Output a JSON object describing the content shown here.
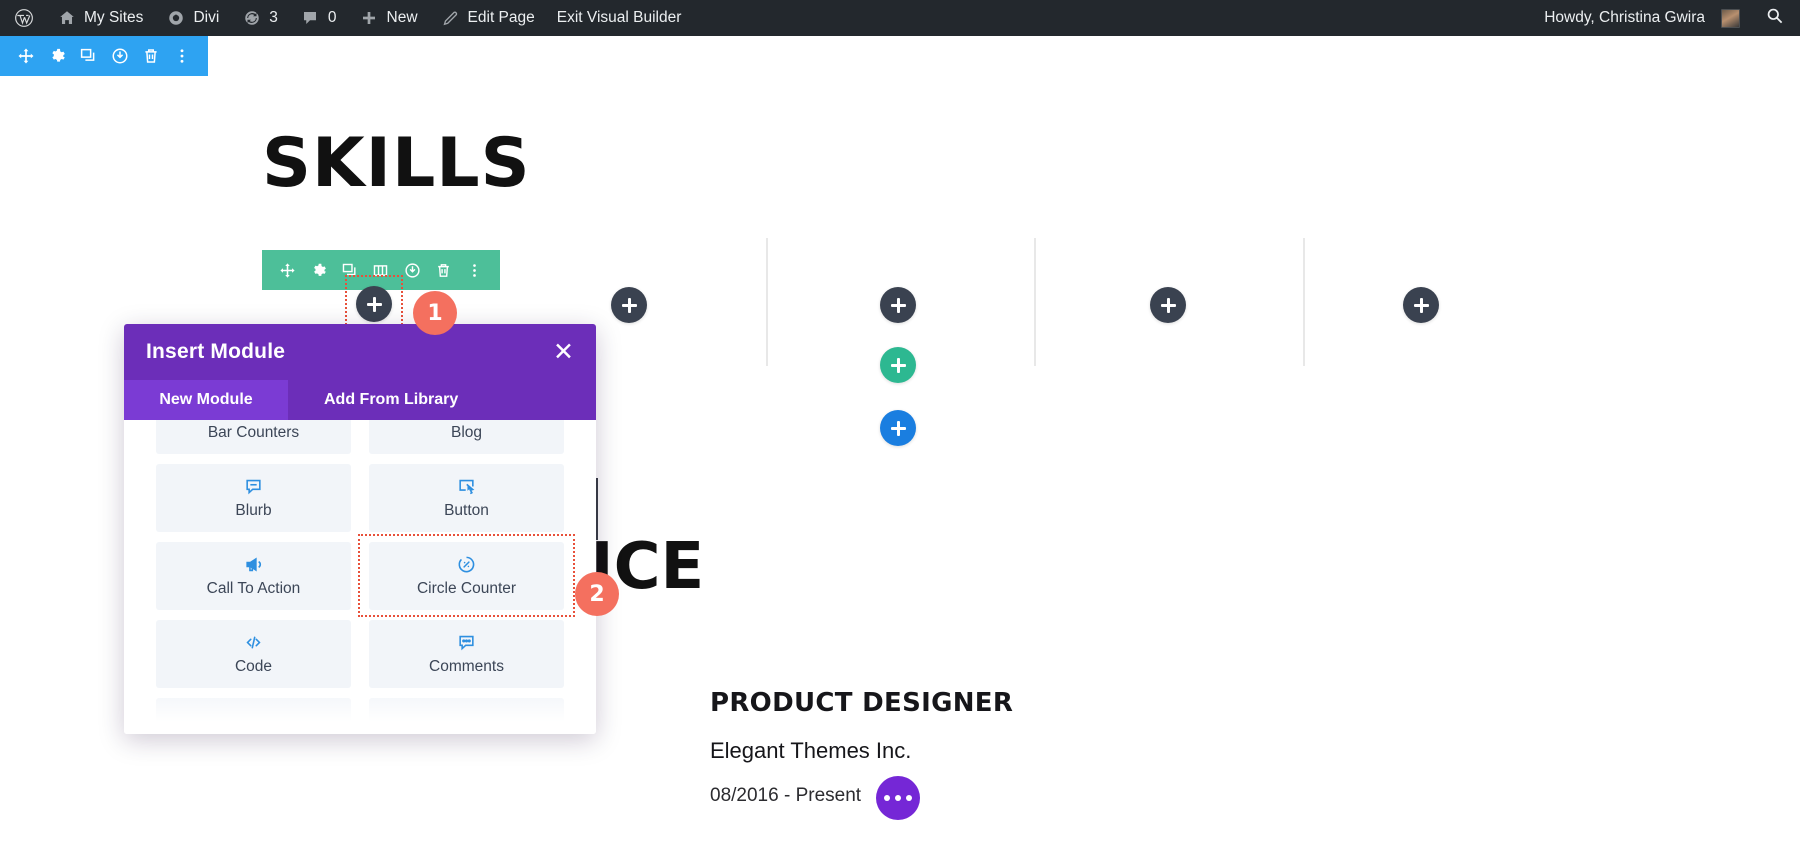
{
  "adminbar": {
    "items": [
      {
        "icon": "wordpress-logo-icon",
        "label": ""
      },
      {
        "icon": "home-icon",
        "label": "My Sites"
      },
      {
        "icon": "divi-gauge-icon",
        "label": "Divi"
      },
      {
        "icon": "update-arrows-icon",
        "label": "3"
      },
      {
        "icon": "comment-bubble-icon",
        "label": "0"
      },
      {
        "icon": "plus-icon",
        "label": "New"
      },
      {
        "icon": "pencil-icon",
        "label": "Edit Page"
      },
      {
        "icon": "",
        "label": "Exit Visual Builder"
      }
    ],
    "howdy": "Howdy, Christina Gwira",
    "search_icon": "search-icon"
  },
  "section_toolbar": {
    "color": "#2ea3f2",
    "icons": [
      "move-icon",
      "gear-icon",
      "duplicate-icon",
      "save-power-icon",
      "trash-icon",
      "more-vertical-icon"
    ]
  },
  "row_toolbar": {
    "color": "#4dbf99",
    "icons": [
      "move-icon",
      "gear-icon",
      "duplicate-icon",
      "columns-icon",
      "save-power-icon",
      "trash-icon",
      "more-vertical-icon"
    ]
  },
  "page": {
    "skills_heading": "SKILLS",
    "experience_heading": "NCE",
    "job_title": "PRODUCT DESIGNER",
    "job_company": "Elegant Themes Inc.",
    "job_dates": "08/2016 - Present",
    "ellipsis_label": "more-options"
  },
  "steps": [
    {
      "number": "1",
      "target": "add-module-plus-button"
    },
    {
      "number": "2",
      "target": "circle-counter-module"
    }
  ],
  "modal": {
    "title": "Insert Module",
    "close_label": "✕",
    "tabs": [
      {
        "label": "New Module",
        "active": true
      },
      {
        "label": "Add From Library",
        "active": false
      }
    ],
    "modules": [
      {
        "label": "Bar Counters",
        "icon": "bar-counters-icon",
        "selected": false
      },
      {
        "label": "Blog",
        "icon": "blog-icon",
        "selected": false
      },
      {
        "label": "Blurb",
        "icon": "blurb-icon",
        "selected": false
      },
      {
        "label": "Button",
        "icon": "button-icon",
        "selected": false
      },
      {
        "label": "Call To Action",
        "icon": "megaphone-icon",
        "selected": false
      },
      {
        "label": "Circle Counter",
        "icon": "circle-counter-icon",
        "selected": true
      },
      {
        "label": "Code",
        "icon": "code-icon",
        "selected": false
      },
      {
        "label": "Comments",
        "icon": "comments-icon",
        "selected": false
      }
    ]
  },
  "colors": {
    "admin_bar": "#23282d",
    "section_blue": "#2ea3f2",
    "row_green": "#4dbf99",
    "modal_purple": "#6c2eb9",
    "modal_tab_active": "#7b3bd4",
    "step_badge": "#f4705f",
    "highlight_outline": "#e8503a",
    "plus_grey": "#3a4250",
    "plus_green": "#2db891",
    "plus_blue": "#1a7ee0",
    "ellipsis_purple": "#7527d6"
  }
}
